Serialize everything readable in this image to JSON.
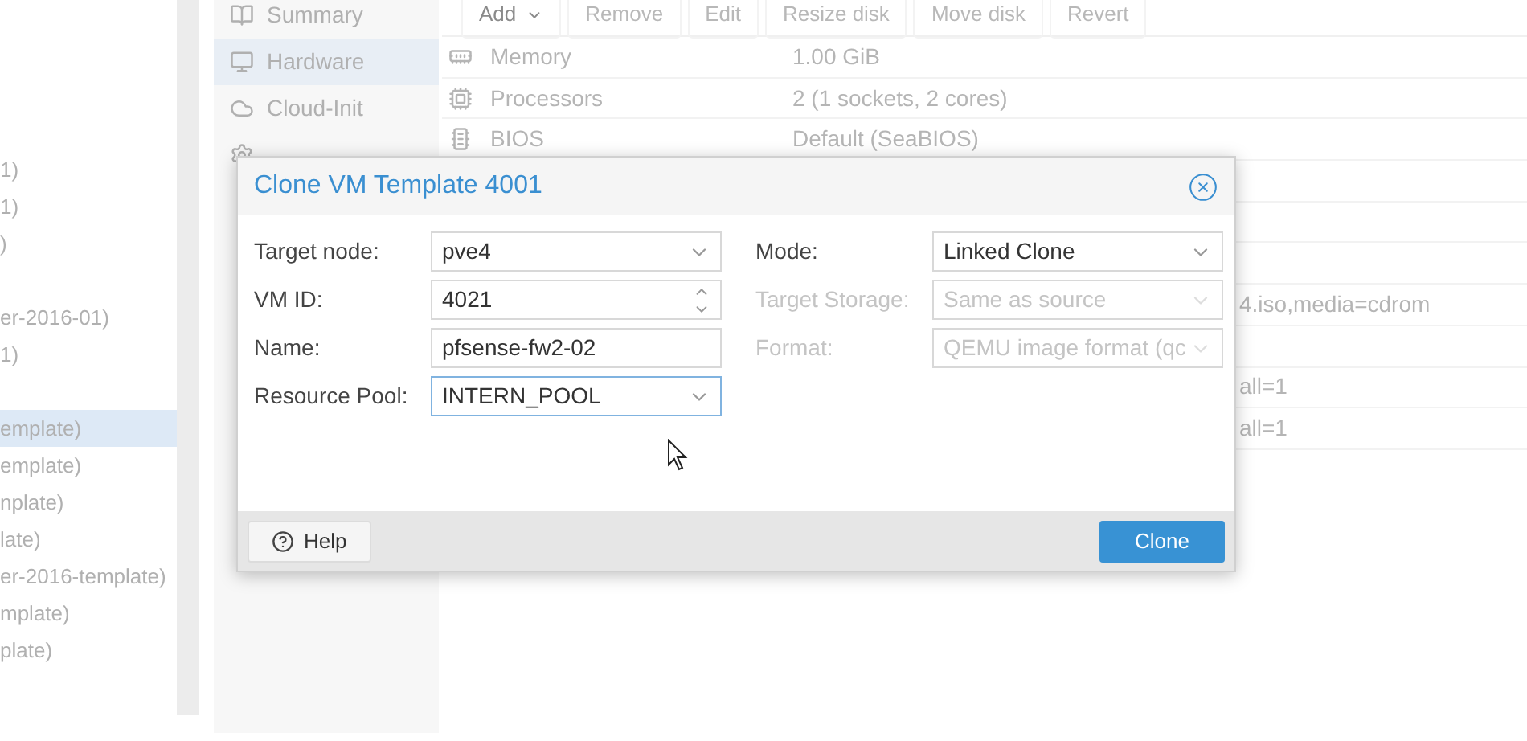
{
  "tree": {
    "groups": [
      {
        "items": [
          {
            "label": "1)",
            "selected": false
          },
          {
            "label": "1)",
            "selected": false
          },
          {
            "label": ")",
            "selected": false
          }
        ]
      },
      {
        "items": [
          {
            "label": "er-2016-01)",
            "selected": false
          },
          {
            "label": "1)",
            "selected": false
          }
        ]
      },
      {
        "items": [
          {
            "label": "emplate)",
            "selected": true
          },
          {
            "label": "emplate)",
            "selected": false
          },
          {
            "label": "nplate)",
            "selected": false
          },
          {
            "label": "late)",
            "selected": false
          },
          {
            "label": "er-2016-template)",
            "selected": false
          },
          {
            "label": "mplate)",
            "selected": false
          },
          {
            "label": "plate)",
            "selected": false
          }
        ]
      }
    ]
  },
  "nav": {
    "items": [
      {
        "label": "Summary",
        "selected": false
      },
      {
        "label": "Hardware",
        "selected": true
      },
      {
        "label": "Cloud-Init",
        "selected": false
      }
    ]
  },
  "toolbar": {
    "buttons": [
      {
        "label": "Add",
        "disabled": false,
        "dropdown": true
      },
      {
        "label": "Remove",
        "disabled": true,
        "dropdown": false
      },
      {
        "label": "Edit",
        "disabled": true,
        "dropdown": false
      },
      {
        "label": "Resize disk",
        "disabled": true,
        "dropdown": false
      },
      {
        "label": "Move disk",
        "disabled": true,
        "dropdown": false
      },
      {
        "label": "Revert",
        "disabled": true,
        "dropdown": false
      }
    ]
  },
  "hardware": {
    "rows": [
      {
        "kind": "full",
        "name": "Memory",
        "value": "1.00 GiB"
      },
      {
        "kind": "full",
        "name": "Processors",
        "value": "2 (1 sockets, 2 cores)"
      },
      {
        "kind": "full",
        "name": "BIOS",
        "value": "Default (SeaBIOS)"
      },
      {
        "kind": "blank"
      },
      {
        "kind": "blank"
      },
      {
        "kind": "blank"
      },
      {
        "kind": "tail",
        "value": "4.iso,media=cdrom"
      },
      {
        "kind": "blank"
      },
      {
        "kind": "tail",
        "value": "all=1"
      },
      {
        "kind": "tail",
        "value": "all=1"
      }
    ]
  },
  "dialog": {
    "title": "Clone VM Template 4001",
    "left_fields": [
      {
        "label": "Target node:",
        "value": "pve4",
        "kind": "select",
        "disabled": false,
        "focused": false
      },
      {
        "label": "VM ID:",
        "value": "4021",
        "kind": "spinner",
        "disabled": false,
        "focused": false
      },
      {
        "label": "Name:",
        "value": "pfsense-fw2-02",
        "kind": "text",
        "disabled": false,
        "focused": false
      },
      {
        "label": "Resource Pool:",
        "value": "INTERN_POOL",
        "kind": "select",
        "disabled": false,
        "focused": true
      }
    ],
    "right_fields": [
      {
        "label": "Mode:",
        "value": "Linked Clone",
        "kind": "select",
        "disabled": false,
        "focused": false
      },
      {
        "label": "Target Storage:",
        "value": "Same as source",
        "kind": "select",
        "disabled": true,
        "focused": false
      },
      {
        "label": "Format:",
        "value": "QEMU image format (qc",
        "kind": "select",
        "disabled": true,
        "focused": false
      }
    ],
    "help_button": "Help",
    "clone_button": "Clone"
  }
}
